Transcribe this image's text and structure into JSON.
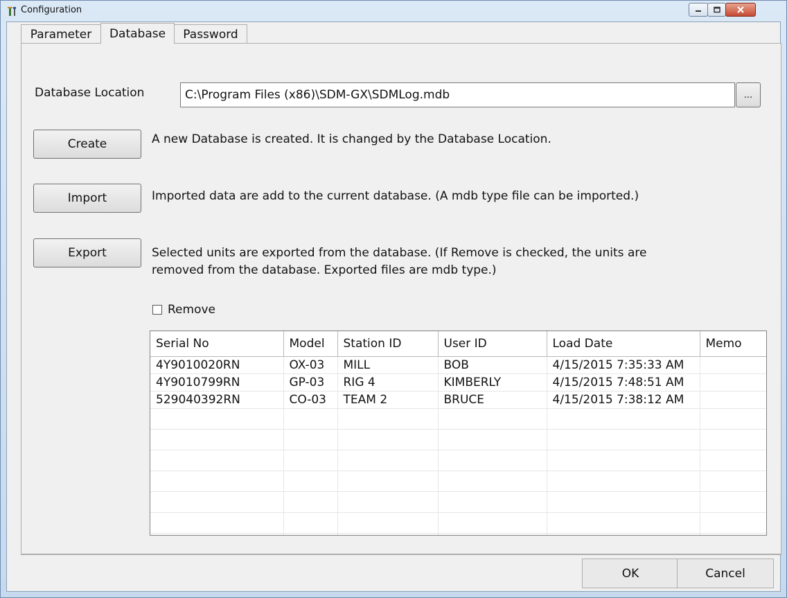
{
  "window": {
    "title": "Configuration"
  },
  "tabs": [
    {
      "label": "Parameter"
    },
    {
      "label": "Database"
    },
    {
      "label": "Password"
    }
  ],
  "database": {
    "location_label": "Database Location",
    "location_value": "C:\\Program Files (x86)\\SDM-GX\\SDMLog.mdb",
    "browse_label": "...",
    "actions": [
      {
        "label": "Create",
        "description": "A new Database is created. It is changed by the Database Location."
      },
      {
        "label": "Import",
        "description": "Imported data are add to the current database. (A mdb type file can be imported.)"
      },
      {
        "label": "Export",
        "description_line1": "Selected units are exported from the database. (If Remove is checked, the units are",
        "description_line2": "removed from the database. Exported files are mdb type.)"
      }
    ],
    "remove_label": "Remove",
    "remove_checked": false
  },
  "table": {
    "columns": [
      "Serial No",
      "Model",
      "Station ID",
      "User ID",
      "Load Date",
      "Memo"
    ],
    "rows": [
      [
        "4Y9010020RN",
        "OX-03",
        "MILL",
        "BOB",
        "4/15/2015 7:35:33 AM",
        ""
      ],
      [
        "4Y9010799RN",
        "GP-03",
        "RIG 4",
        "KIMBERLY",
        "4/15/2015 7:48:51 AM",
        ""
      ],
      [
        "529040392RN",
        "CO-03",
        "TEAM 2",
        "BRUCE",
        "4/15/2015 7:38:12 AM",
        ""
      ]
    ]
  },
  "buttons": {
    "ok": "OK",
    "cancel": "Cancel"
  },
  "colors": {
    "accent": "#c74a33",
    "titlebar": "#c6d9ee"
  }
}
